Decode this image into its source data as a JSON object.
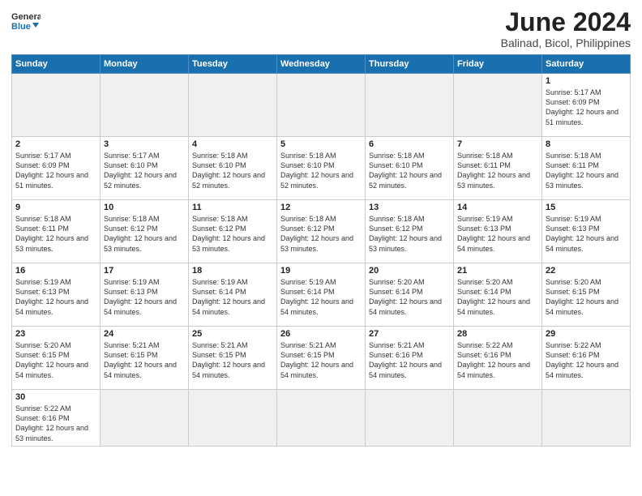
{
  "logo": {
    "text_general": "General",
    "text_blue": "Blue"
  },
  "title": {
    "month_year": "June 2024",
    "location": "Balinad, Bicol, Philippines"
  },
  "weekdays": [
    "Sunday",
    "Monday",
    "Tuesday",
    "Wednesday",
    "Thursday",
    "Friday",
    "Saturday"
  ],
  "weeks": [
    [
      {
        "day": "",
        "empty": true
      },
      {
        "day": "",
        "empty": true
      },
      {
        "day": "",
        "empty": true
      },
      {
        "day": "",
        "empty": true
      },
      {
        "day": "",
        "empty": true
      },
      {
        "day": "",
        "empty": true
      },
      {
        "day": "1",
        "sunrise": "5:17 AM",
        "sunset": "6:09 PM",
        "daylight": "12 hours and 51 minutes."
      }
    ],
    [
      {
        "day": "2",
        "sunrise": "5:17 AM",
        "sunset": "6:09 PM",
        "daylight": "12 hours and 51 minutes."
      },
      {
        "day": "3",
        "sunrise": "5:17 AM",
        "sunset": "6:10 PM",
        "daylight": "12 hours and 52 minutes."
      },
      {
        "day": "4",
        "sunrise": "5:18 AM",
        "sunset": "6:10 PM",
        "daylight": "12 hours and 52 minutes."
      },
      {
        "day": "5",
        "sunrise": "5:18 AM",
        "sunset": "6:10 PM",
        "daylight": "12 hours and 52 minutes."
      },
      {
        "day": "6",
        "sunrise": "5:18 AM",
        "sunset": "6:10 PM",
        "daylight": "12 hours and 52 minutes."
      },
      {
        "day": "7",
        "sunrise": "5:18 AM",
        "sunset": "6:11 PM",
        "daylight": "12 hours and 53 minutes."
      },
      {
        "day": "8",
        "sunrise": "5:18 AM",
        "sunset": "6:11 PM",
        "daylight": "12 hours and 53 minutes."
      }
    ],
    [
      {
        "day": "9",
        "sunrise": "5:18 AM",
        "sunset": "6:11 PM",
        "daylight": "12 hours and 53 minutes."
      },
      {
        "day": "10",
        "sunrise": "5:18 AM",
        "sunset": "6:12 PM",
        "daylight": "12 hours and 53 minutes."
      },
      {
        "day": "11",
        "sunrise": "5:18 AM",
        "sunset": "6:12 PM",
        "daylight": "12 hours and 53 minutes."
      },
      {
        "day": "12",
        "sunrise": "5:18 AM",
        "sunset": "6:12 PM",
        "daylight": "12 hours and 53 minutes."
      },
      {
        "day": "13",
        "sunrise": "5:18 AM",
        "sunset": "6:12 PM",
        "daylight": "12 hours and 53 minutes."
      },
      {
        "day": "14",
        "sunrise": "5:19 AM",
        "sunset": "6:13 PM",
        "daylight": "12 hours and 54 minutes."
      },
      {
        "day": "15",
        "sunrise": "5:19 AM",
        "sunset": "6:13 PM",
        "daylight": "12 hours and 54 minutes."
      }
    ],
    [
      {
        "day": "16",
        "sunrise": "5:19 AM",
        "sunset": "6:13 PM",
        "daylight": "12 hours and 54 minutes."
      },
      {
        "day": "17",
        "sunrise": "5:19 AM",
        "sunset": "6:13 PM",
        "daylight": "12 hours and 54 minutes."
      },
      {
        "day": "18",
        "sunrise": "5:19 AM",
        "sunset": "6:14 PM",
        "daylight": "12 hours and 54 minutes."
      },
      {
        "day": "19",
        "sunrise": "5:19 AM",
        "sunset": "6:14 PM",
        "daylight": "12 hours and 54 minutes."
      },
      {
        "day": "20",
        "sunrise": "5:20 AM",
        "sunset": "6:14 PM",
        "daylight": "12 hours and 54 minutes."
      },
      {
        "day": "21",
        "sunrise": "5:20 AM",
        "sunset": "6:14 PM",
        "daylight": "12 hours and 54 minutes."
      },
      {
        "day": "22",
        "sunrise": "5:20 AM",
        "sunset": "6:15 PM",
        "daylight": "12 hours and 54 minutes."
      }
    ],
    [
      {
        "day": "23",
        "sunrise": "5:20 AM",
        "sunset": "6:15 PM",
        "daylight": "12 hours and 54 minutes."
      },
      {
        "day": "24",
        "sunrise": "5:21 AM",
        "sunset": "6:15 PM",
        "daylight": "12 hours and 54 minutes."
      },
      {
        "day": "25",
        "sunrise": "5:21 AM",
        "sunset": "6:15 PM",
        "daylight": "12 hours and 54 minutes."
      },
      {
        "day": "26",
        "sunrise": "5:21 AM",
        "sunset": "6:15 PM",
        "daylight": "12 hours and 54 minutes."
      },
      {
        "day": "27",
        "sunrise": "5:21 AM",
        "sunset": "6:16 PM",
        "daylight": "12 hours and 54 minutes."
      },
      {
        "day": "28",
        "sunrise": "5:22 AM",
        "sunset": "6:16 PM",
        "daylight": "12 hours and 54 minutes."
      },
      {
        "day": "29",
        "sunrise": "5:22 AM",
        "sunset": "6:16 PM",
        "daylight": "12 hours and 54 minutes."
      }
    ],
    [
      {
        "day": "30",
        "sunrise": "5:22 AM",
        "sunset": "6:16 PM",
        "daylight": "12 hours and 53 minutes."
      },
      {
        "day": "",
        "empty": true
      },
      {
        "day": "",
        "empty": true
      },
      {
        "day": "",
        "empty": true
      },
      {
        "day": "",
        "empty": true
      },
      {
        "day": "",
        "empty": true
      },
      {
        "day": "",
        "empty": true
      }
    ]
  ]
}
